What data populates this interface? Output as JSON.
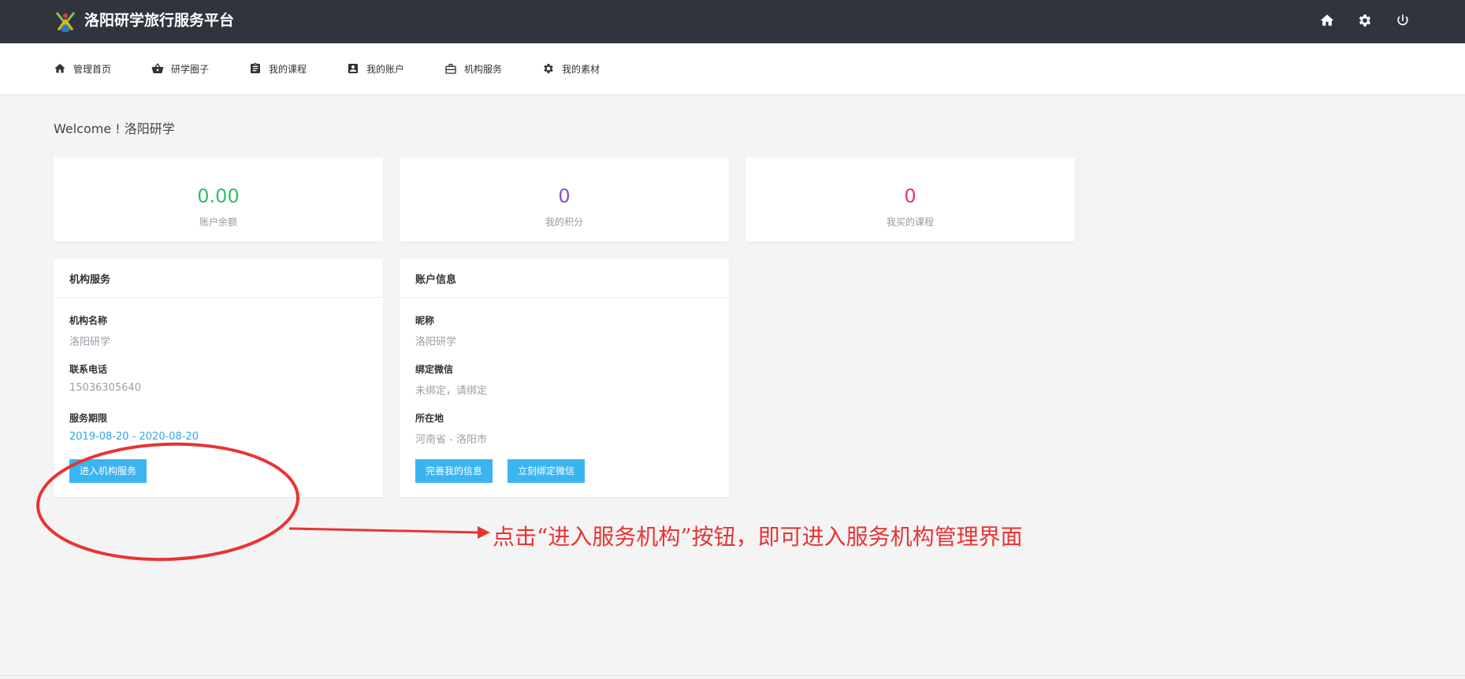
{
  "header": {
    "title": "洛阳研学旅行服务平台",
    "right_icons": [
      "home-icon",
      "gear-icon",
      "power-icon"
    ]
  },
  "nav": {
    "items": [
      {
        "label": "管理首页",
        "icon": "home-icon"
      },
      {
        "label": "研学圈子",
        "icon": "basket-icon"
      },
      {
        "label": "我的课程",
        "icon": "clipboard-icon"
      },
      {
        "label": "我的账户",
        "icon": "account-box-icon"
      },
      {
        "label": "机构服务",
        "icon": "briefcase-icon"
      },
      {
        "label": "我的素材",
        "icon": "gear-icon"
      }
    ]
  },
  "welcome": "Welcome ! 洛阳研学",
  "stats": [
    {
      "value": "0.00",
      "label": "账户余额",
      "color": "#2ebd6b"
    },
    {
      "value": "0",
      "label": "我的积分",
      "color": "#8a4fc9"
    },
    {
      "value": "0",
      "label": "我买的课程",
      "color": "#e3385b"
    }
  ],
  "org_panel": {
    "title": "机构服务",
    "fields": [
      {
        "label": "机构名称",
        "value": "洛阳研学"
      },
      {
        "label": "联系电话",
        "value": "15036305640"
      },
      {
        "label": "服务期限",
        "value": "2019-08-20 - 2020-08-20"
      }
    ],
    "button": "进入机构服务"
  },
  "account_panel": {
    "title": "账户信息",
    "fields": [
      {
        "label": "昵称",
        "value": "洛阳研学"
      },
      {
        "label": "绑定微信",
        "value": "未绑定，请绑定"
      },
      {
        "label": "所在地",
        "value": "河南省 - 洛阳市"
      }
    ],
    "buttons": [
      "完善我的信息",
      "立刻绑定微信"
    ]
  },
  "annotation": {
    "text": "点击“进入服务机构”按钮，即可进入服务机构管理界面",
    "color": "#e83434"
  },
  "colors": {
    "topbar": "#2f343d",
    "button": "#3bb4f2",
    "link": "#2ea8e0"
  }
}
